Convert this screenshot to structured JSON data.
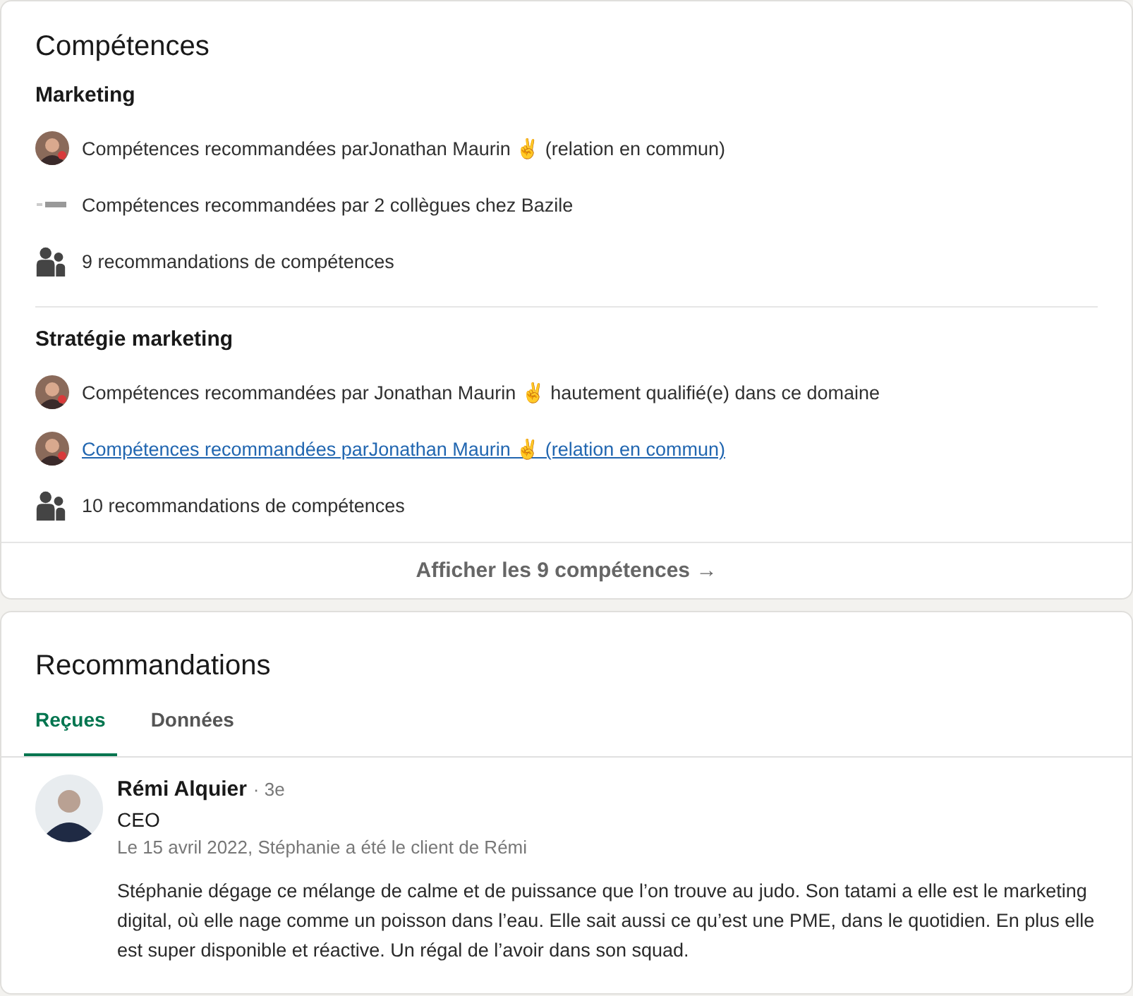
{
  "skills": {
    "title": "Compétences",
    "groups": [
      {
        "name": "Marketing",
        "endorsements": [
          {
            "kind": "avatar",
            "text": "Compétences recommandées parJonathan Maurin ✌ (relation en commun)",
            "link": false
          },
          {
            "kind": "logo",
            "text": "Compétences recommandées par 2 collègues chez Bazile",
            "link": false
          },
          {
            "kind": "people",
            "text": "9 recommandations de compétences",
            "link": false
          }
        ]
      },
      {
        "name": "Stratégie marketing",
        "endorsements": [
          {
            "kind": "avatar",
            "text": "Compétences recommandées par Jonathan Maurin ✌ hautement qualifié(e) dans ce domaine",
            "link": false
          },
          {
            "kind": "avatar",
            "text": "Compétences recommandées parJonathan Maurin ✌ (relation en commun)",
            "link": true
          },
          {
            "kind": "people",
            "text": "10 recommandations de compétences",
            "link": false
          }
        ]
      }
    ],
    "show_all": "Afficher les 9 compétences →"
  },
  "recommendations": {
    "title": "Recommandations",
    "tabs": [
      {
        "label": "Reçues",
        "selected": true
      },
      {
        "label": "Données",
        "selected": false
      }
    ],
    "items": [
      {
        "name": "Rémi Alquier",
        "degree": "· 3e",
        "title": "CEO",
        "relation": "Le 15 avril 2022, Stéphanie a été le client de Rémi",
        "text": "Stéphanie dégage ce mélange de calme et de puissance que l’on trouve au judo. Son tatami a elle est le marketing digital, où elle nage comme un poisson dans l’eau. Elle sait aussi ce qu’est une PME, dans le quotidien. En plus elle est super disponible et réactive. Un régal de l’avoir dans son squad."
      }
    ]
  }
}
